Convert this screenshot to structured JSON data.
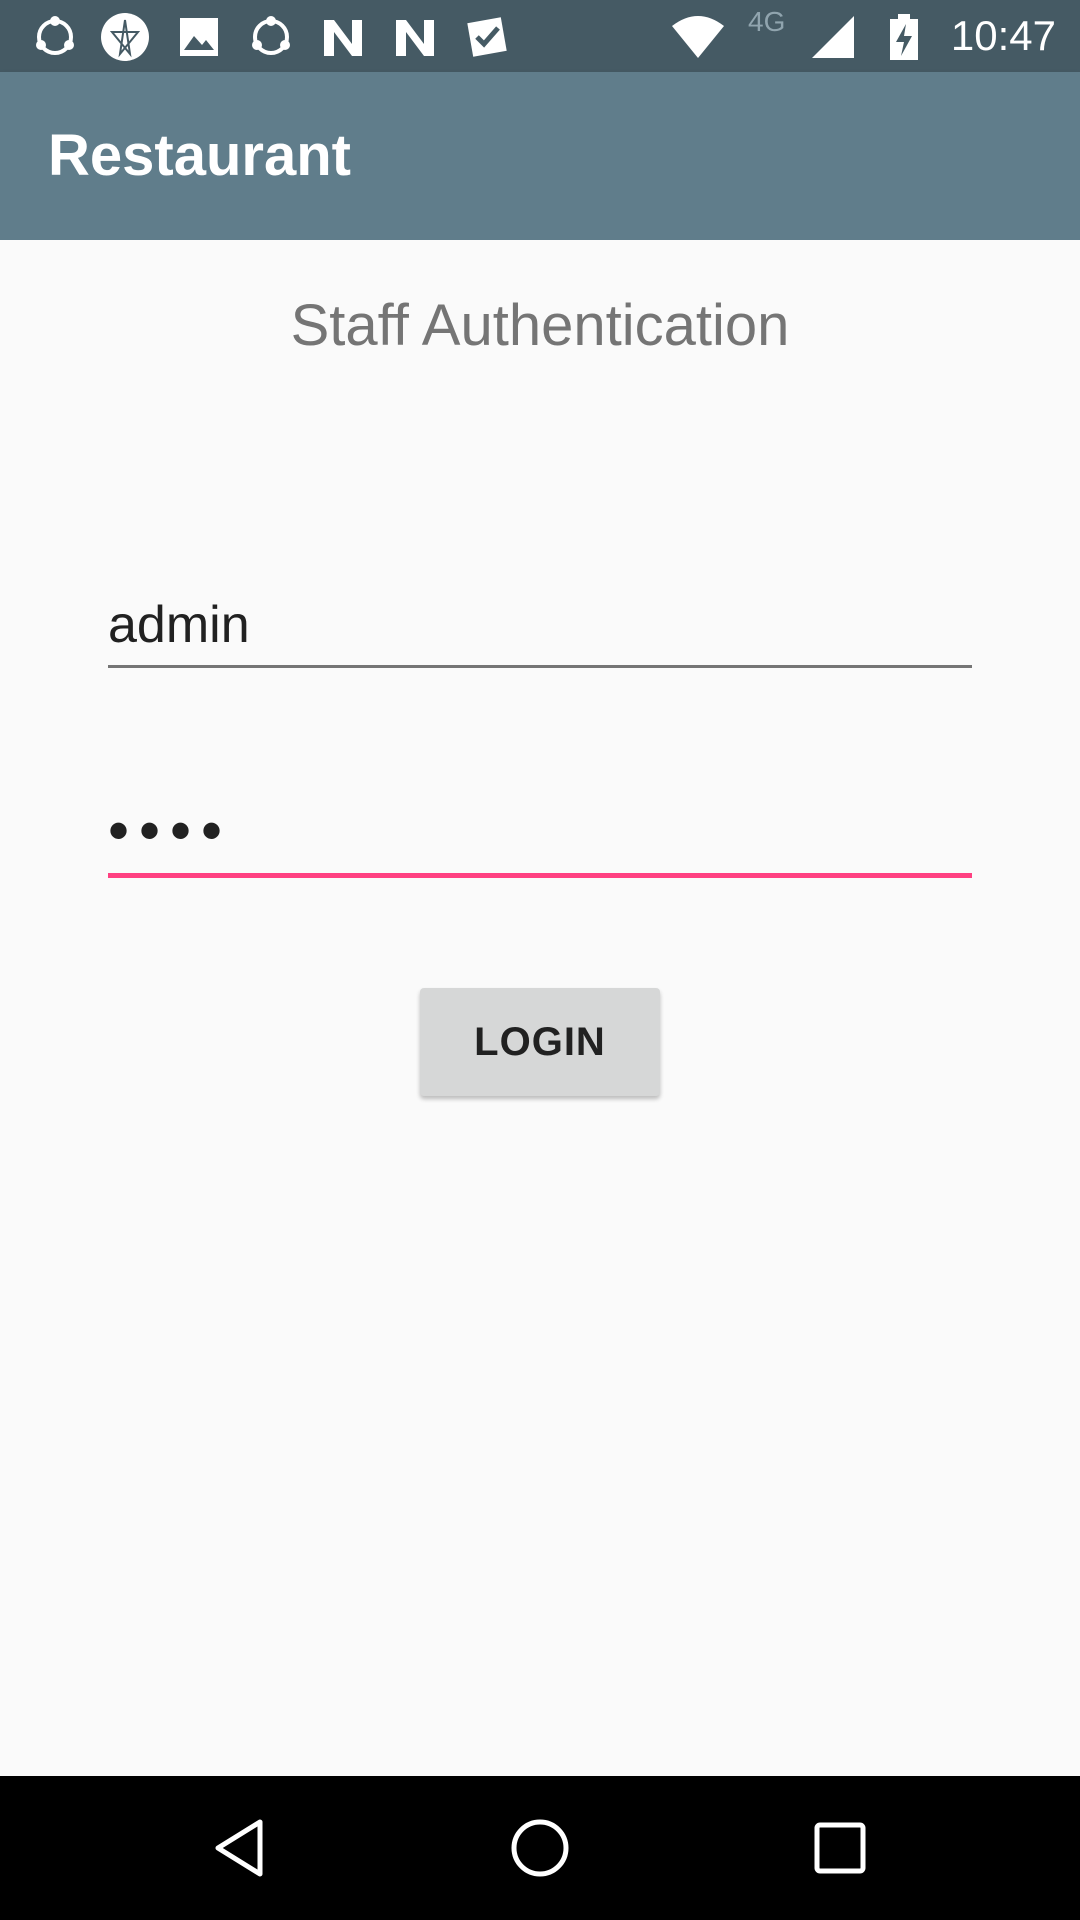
{
  "status_bar": {
    "time": "10:47",
    "network": "4G",
    "icons": [
      "share-icon",
      "compass-icon",
      "image-icon",
      "share-icon",
      "n-app-icon",
      "n-app-icon",
      "checkbox-icon",
      "wifi-icon",
      "signal-icon",
      "battery-charging-icon"
    ]
  },
  "app_bar": {
    "title": "Restaurant",
    "color": "#607d8b"
  },
  "login": {
    "heading": "Staff Authentication",
    "username_value": "admin",
    "password_mask": "••••",
    "login_label": "LOGIN",
    "accent_color": "#ff4081"
  },
  "nav_bar": {
    "buttons": [
      "back-icon",
      "home-icon",
      "recents-icon"
    ]
  }
}
